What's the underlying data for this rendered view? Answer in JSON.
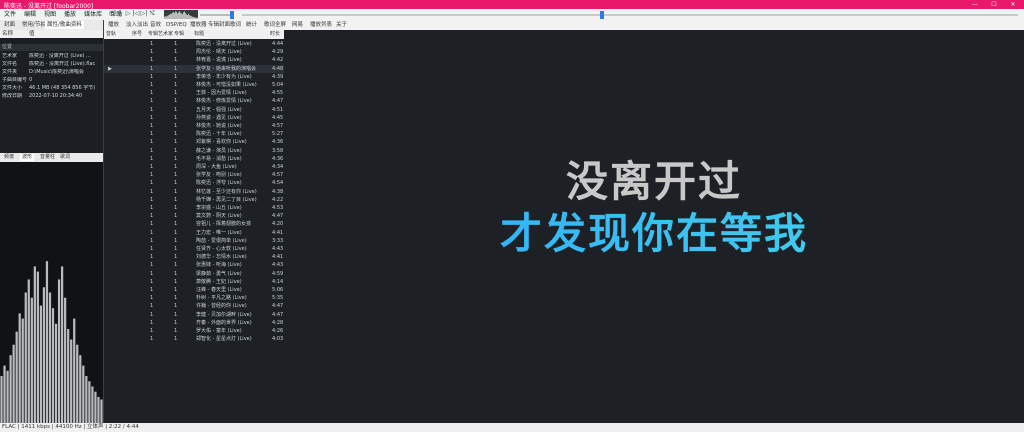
{
  "window": {
    "title": "陈奕迅 - 没离开过 [foobar2000]",
    "minimize": "—",
    "maximize": "☐",
    "close": "✕"
  },
  "menu": [
    "文件",
    "编辑",
    "视图",
    "播放",
    "媒体库",
    "帮助"
  ],
  "transport": {
    "stop": "▢",
    "play": "▷",
    "pause": "‖",
    "prev": "|◁",
    "next": "▷|",
    "random": "⤭"
  },
  "left_tabs": [
    "封面",
    "常用/节拍",
    "属性/歌曲资料"
  ],
  "props": {
    "col_name": "名称",
    "col_value": "值",
    "section": "位置",
    "rows": [
      {
        "k": "艺术家",
        "v": "陈奕迅 · 没离开过 (Live) ..."
      },
      {
        "k": "文件名",
        "v": "陈奕迅 - 没离开过 (Live).flac"
      },
      {
        "k": "文件夹",
        "v": "D:\\Music\\陈奕迅\\演唱会"
      },
      {
        "k": "子曲目编号",
        "v": "0"
      },
      {
        "k": "文件大小",
        "v": "46.1 MB (48 354 856 字节)"
      },
      {
        "k": "修改日期",
        "v": "2022-07-10 20:34:40"
      }
    ]
  },
  "lower_tabs": [
    "频谱",
    "波形",
    "音量柱",
    "歌词"
  ],
  "toolbar2": [
    "播放",
    "淡入淡出",
    "音效",
    "DSP/EQ",
    "播放器",
    "专辑封面",
    "歌词",
    "统计",
    "歌词全屏",
    "网易",
    "播放列表",
    "关于"
  ],
  "list_header": [
    "音轨",
    "序号",
    "专辑艺术家",
    "专辑",
    "标题",
    "时长"
  ],
  "tracks": [
    {
      "n": "1",
      "d": "1",
      "t": "陈奕迅 - 没离开过 (Live)",
      "len": "4:44",
      "playing": false
    },
    {
      "n": "1",
      "d": "1",
      "t": "周杰伦 - 晴天 (Live)",
      "len": "4:29",
      "playing": false
    },
    {
      "n": "1",
      "d": "1",
      "t": "林宥嘉 - 说谎 (Live)",
      "len": "4:42",
      "playing": false
    },
    {
      "n": "1",
      "d": "1",
      "t": "张学友 - 她来听我的演唱会",
      "len": "4:48",
      "playing": true
    },
    {
      "n": "1",
      "d": "1",
      "t": "李荣浩 - 年少有为 (Live)",
      "len": "4:39",
      "playing": false
    },
    {
      "n": "1",
      "d": "1",
      "t": "林俊杰 - 可惜没如果 (Live)",
      "len": "5:04",
      "playing": false
    },
    {
      "n": "1",
      "d": "1",
      "t": "王菲 - 因为爱情 (Live)",
      "len": "4:55",
      "playing": false
    },
    {
      "n": "1",
      "d": "1",
      "t": "林俊杰 - 修炼爱情 (Live)",
      "len": "4:47",
      "playing": false
    },
    {
      "n": "1",
      "d": "1",
      "t": "五月天 - 倔强 (Live)",
      "len": "4:51",
      "playing": false
    },
    {
      "n": "1",
      "d": "1",
      "t": "孙燕姿 - 遇见 (Live)",
      "len": "4:45",
      "playing": false
    },
    {
      "n": "1",
      "d": "1",
      "t": "林俊杰 - 她说 (Live)",
      "len": "4:57",
      "playing": false
    },
    {
      "n": "1",
      "d": "1",
      "t": "陈奕迅 - 十年 (Live)",
      "len": "5:27",
      "playing": false
    },
    {
      "n": "1",
      "d": "1",
      "t": "邓紫棋 - 喜欢你 (Live)",
      "len": "4:36",
      "playing": false
    },
    {
      "n": "1",
      "d": "1",
      "t": "薛之谦 - 演员 (Live)",
      "len": "3:58",
      "playing": false
    },
    {
      "n": "1",
      "d": "1",
      "t": "毛不易 - 消愁 (Live)",
      "len": "4:36",
      "playing": false
    },
    {
      "n": "1",
      "d": "1",
      "t": "周深 - 大鱼 (Live)",
      "len": "4:34",
      "playing": false
    },
    {
      "n": "1",
      "d": "1",
      "t": "张学友 - 吻别 (Live)",
      "len": "4:57",
      "playing": false
    },
    {
      "n": "1",
      "d": "1",
      "t": "陈奕迅 - 浮夸 (Live)",
      "len": "4:54",
      "playing": false
    },
    {
      "n": "1",
      "d": "1",
      "t": "林忆莲 - 至少还有你 (Live)",
      "len": "4:38",
      "playing": false
    },
    {
      "n": "1",
      "d": "1",
      "t": "杨千嬅 - 再见二丁目 (Live)",
      "len": "4:22",
      "playing": false
    },
    {
      "n": "1",
      "d": "1",
      "t": "李宗盛 - 山丘 (Live)",
      "len": "4:53",
      "playing": false
    },
    {
      "n": "1",
      "d": "1",
      "t": "莫文蔚 - 阴天 (Live)",
      "len": "4:47",
      "playing": false
    },
    {
      "n": "1",
      "d": "1",
      "t": "容祖儿 - 挥着翅膀的女孩",
      "len": "4:20",
      "playing": false
    },
    {
      "n": "1",
      "d": "1",
      "t": "王力宏 - 唯一 (Live)",
      "len": "4:41",
      "playing": false
    },
    {
      "n": "1",
      "d": "1",
      "t": "陶喆 - 爱很简单 (Live)",
      "len": "3:33",
      "playing": false
    },
    {
      "n": "1",
      "d": "1",
      "t": "任贤齐 - 心太软 (Live)",
      "len": "4:43",
      "playing": false
    },
    {
      "n": "1",
      "d": "1",
      "t": "刘德华 - 忘情水 (Live)",
      "len": "4:41",
      "playing": false
    },
    {
      "n": "1",
      "d": "1",
      "t": "张惠妹 - 听海 (Live)",
      "len": "4:43",
      "playing": false
    },
    {
      "n": "1",
      "d": "1",
      "t": "梁静茹 - 勇气 (Live)",
      "len": "4:59",
      "playing": false
    },
    {
      "n": "1",
      "d": "1",
      "t": "萧敬腾 - 王妃 (Live)",
      "len": "4:14",
      "playing": false
    },
    {
      "n": "1",
      "d": "1",
      "t": "汪峰 - 春天里 (Live)",
      "len": "5:06",
      "playing": false
    },
    {
      "n": "1",
      "d": "1",
      "t": "朴树 - 平凡之路 (Live)",
      "len": "5:35",
      "playing": false
    },
    {
      "n": "1",
      "d": "1",
      "t": "许巍 - 曾经的你 (Live)",
      "len": "4:47",
      "playing": false
    },
    {
      "n": "1",
      "d": "1",
      "t": "李健 - 贝加尔湖畔 (Live)",
      "len": "4:47",
      "playing": false
    },
    {
      "n": "1",
      "d": "1",
      "t": "齐秦 - 外面的世界 (Live)",
      "len": "4:28",
      "playing": false
    },
    {
      "n": "1",
      "d": "1",
      "t": "罗大佑 - 童年 (Live)",
      "len": "4:26",
      "playing": false
    },
    {
      "n": "1",
      "d": "1",
      "t": "郑智化 - 星星点灯 (Live)",
      "len": "4:03",
      "playing": false
    }
  ],
  "lyrics": {
    "line1": "没离开过",
    "line2": "才发现你在等我"
  },
  "status": "FLAC | 1411 kbps | 44100 Hz | 立体声 | 2:22 / 4:44",
  "colors": {
    "accent": "#e8196b",
    "lyric_highlight": "#2aa7ff",
    "progress_knob": "#2a7de1"
  },
  "spectrum": {
    "levels": [
      0.18,
      0.22,
      0.2,
      0.26,
      0.3,
      0.35,
      0.42,
      0.4,
      0.5,
      0.55,
      0.48,
      0.6,
      0.58,
      0.45,
      0.52,
      0.62,
      0.5,
      0.44,
      0.38,
      0.55,
      0.6,
      0.48,
      0.36,
      0.32,
      0.4,
      0.3,
      0.26,
      0.22,
      0.18,
      0.16,
      0.14,
      0.12,
      0.1,
      0.09
    ]
  }
}
